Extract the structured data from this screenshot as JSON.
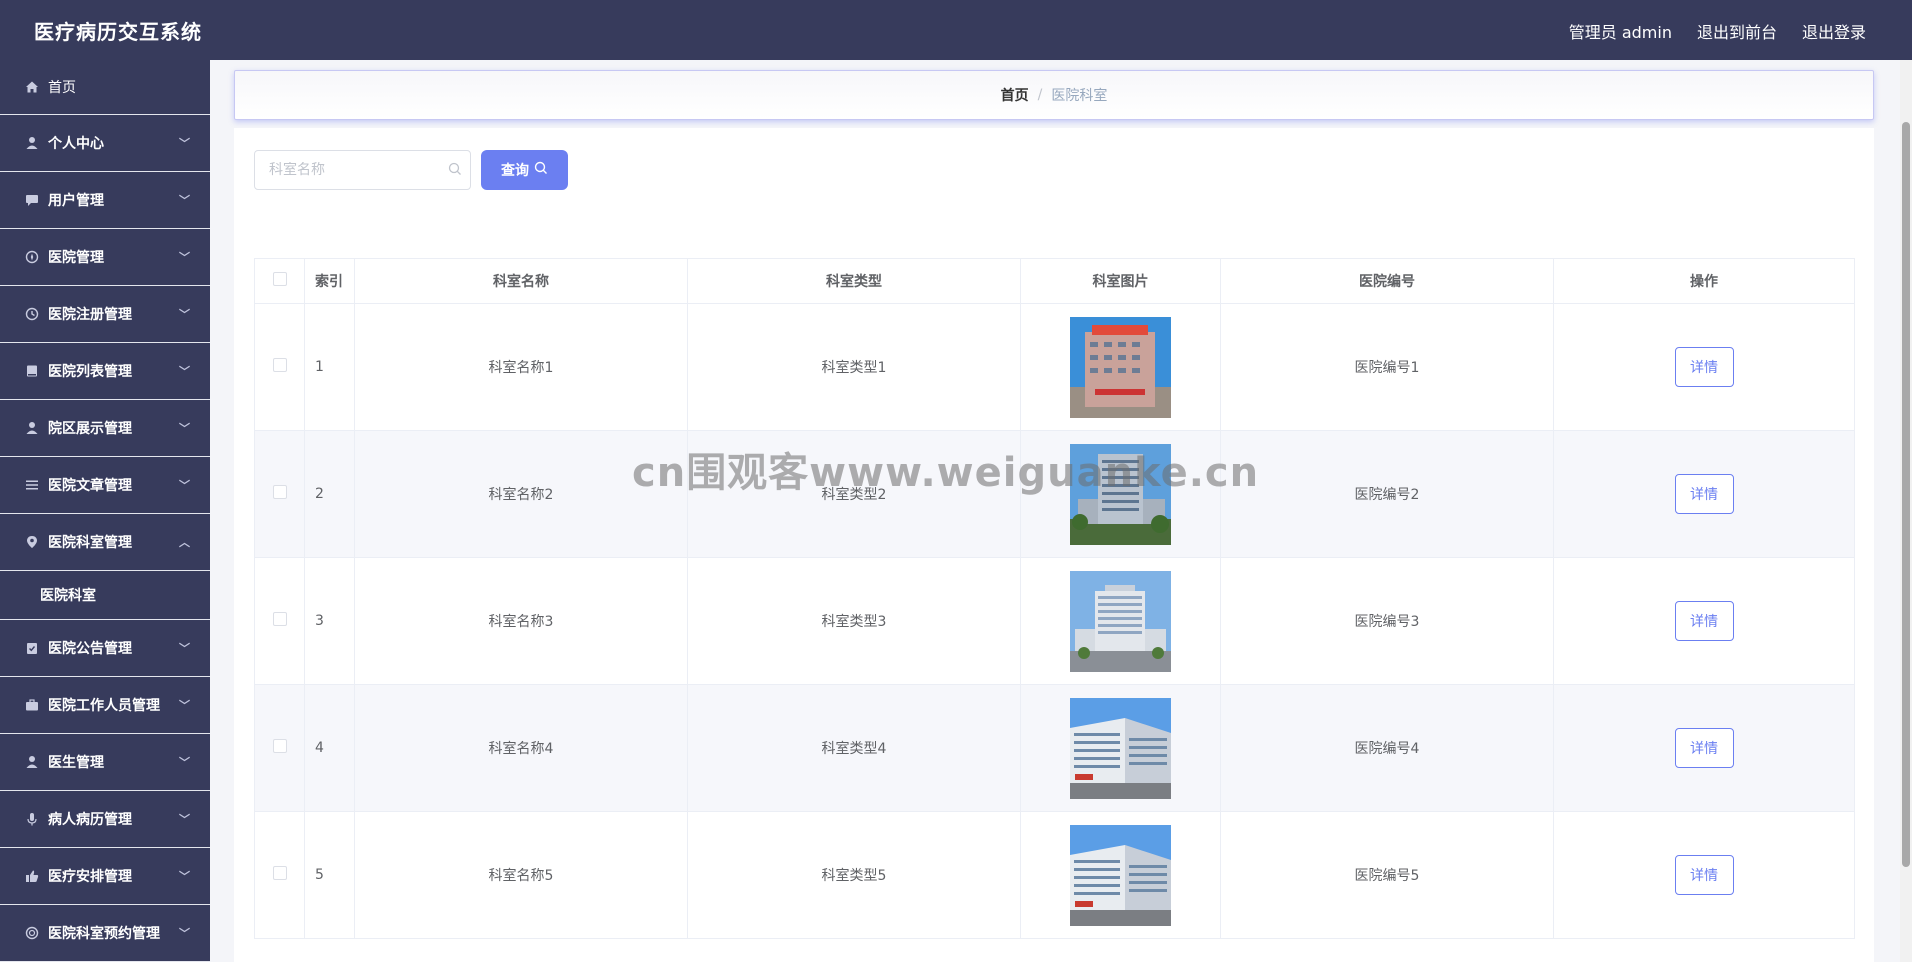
{
  "header": {
    "title": "医疗病历交互系统",
    "admin_label": "管理员 admin",
    "front_label": "退出到前台",
    "logout_label": "退出登录"
  },
  "sidebar": {
    "items": [
      {
        "label": "首页",
        "icon": "home-icon"
      },
      {
        "label": "个人中心",
        "icon": "user-icon"
      },
      {
        "label": "用户管理",
        "icon": "chat-icon"
      },
      {
        "label": "医院管理",
        "icon": "compass-icon"
      },
      {
        "label": "医院注册管理",
        "icon": "clock-icon"
      },
      {
        "label": "医院列表管理",
        "icon": "book-icon"
      },
      {
        "label": "院区展示管理",
        "icon": "user-icon"
      },
      {
        "label": "医院文章管理",
        "icon": "list-icon"
      },
      {
        "label": "医院科室管理",
        "icon": "pin-icon"
      },
      {
        "label": "医院公告管理",
        "icon": "clipboard-icon"
      },
      {
        "label": "医院工作人员管理",
        "icon": "briefcase-icon"
      },
      {
        "label": "医生管理",
        "icon": "user-icon"
      },
      {
        "label": "病人病历管理",
        "icon": "mic-icon"
      },
      {
        "label": "医疗安排管理",
        "icon": "thumb-icon"
      },
      {
        "label": "医院科室预约管理",
        "icon": "circle-icon"
      }
    ],
    "sub_item": "医院科室"
  },
  "breadcrumb": {
    "home": "首页",
    "separator": "/",
    "current": "医院科室"
  },
  "search": {
    "placeholder": "科室名称",
    "value": "",
    "button_label": "查询"
  },
  "table": {
    "columns": [
      "索引",
      "科室名称",
      "科室类型",
      "科室图片",
      "医院编号",
      "操作"
    ],
    "rows": [
      {
        "index": "1",
        "name": "科室名称1",
        "type": "科室类型1",
        "hospital": "医院编号1",
        "action": "详情"
      },
      {
        "index": "2",
        "name": "科室名称2",
        "type": "科室类型2",
        "hospital": "医院编号2",
        "action": "详情"
      },
      {
        "index": "3",
        "name": "科室名称3",
        "type": "科室类型3",
        "hospital": "医院编号3",
        "action": "详情"
      },
      {
        "index": "4",
        "name": "科室名称4",
        "type": "科室类型4",
        "hospital": "医院编号4",
        "action": "详情"
      },
      {
        "index": "5",
        "name": "科室名称5",
        "type": "科室类型5",
        "hospital": "医院编号5",
        "action": "详情"
      }
    ]
  },
  "watermark": "cn围观客www.weiguanke.cn",
  "colors": {
    "sidebar_bg": "#373b5c",
    "accent": "#6b7ff1",
    "row_alt": "#f6f7fb"
  }
}
